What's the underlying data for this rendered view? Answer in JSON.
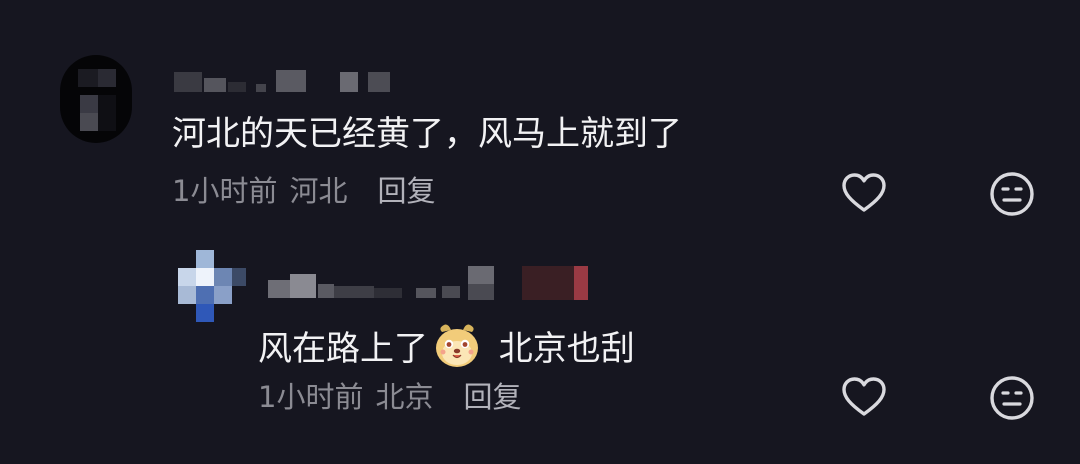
{
  "comments": [
    {
      "text": "河北的天已经黄了，风马上就到了",
      "time": "1小时前",
      "location": "河北",
      "reply_label": "回复",
      "like_icon": "heart-outline-icon",
      "dislike_icon": "meh-face-icon"
    },
    {
      "text_before": "风在路上了",
      "emoji": "dog-face-emoji",
      "text_after": " 北京也刮",
      "time": "1小时前",
      "location": "北京",
      "reply_label": "回复",
      "like_icon": "heart-outline-icon",
      "dislike_icon": "meh-face-icon"
    }
  ]
}
